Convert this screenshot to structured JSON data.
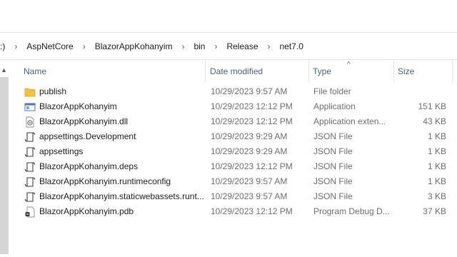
{
  "breadcrumb": {
    "prefix": ":)",
    "items": [
      "AspNetCore",
      "BlazorAppKohanyim",
      "bin",
      "Release",
      "net7.0"
    ]
  },
  "columns": {
    "name": "Name",
    "date": "Date modified",
    "type": "Type",
    "size": "Size"
  },
  "files": [
    {
      "icon": "folder-icon",
      "name": "publish",
      "date": "10/29/2023 9:57 AM",
      "type": "File folder",
      "size": ""
    },
    {
      "icon": "application-icon",
      "name": "BlazorAppKohanyim",
      "date": "10/29/2023 12:12 PM",
      "type": "Application",
      "size": "151 KB"
    },
    {
      "icon": "dll-icon",
      "name": "BlazorAppKohanyim.dll",
      "date": "10/29/2023 12:12 PM",
      "type": "Application exten...",
      "size": "43 KB"
    },
    {
      "icon": "json-file-icon",
      "name": "appsettings.Development",
      "date": "10/29/2023 9:29 AM",
      "type": "JSON File",
      "size": "1 KB"
    },
    {
      "icon": "json-file-icon",
      "name": "appsettings",
      "date": "10/29/2023 9:29 AM",
      "type": "JSON File",
      "size": "1 KB"
    },
    {
      "icon": "json-file-icon",
      "name": "BlazorAppKohanyim.deps",
      "date": "10/29/2023 12:12 PM",
      "type": "JSON File",
      "size": "1 KB"
    },
    {
      "icon": "json-file-icon",
      "name": "BlazorAppKohanyim.runtimeconfig",
      "date": "10/29/2023 9:57 AM",
      "type": "JSON File",
      "size": "1 KB"
    },
    {
      "icon": "json-file-icon",
      "name": "BlazorAppKohanyim.staticwebassets.runt...",
      "date": "10/29/2023 9:57 AM",
      "type": "JSON File",
      "size": "3 KB"
    },
    {
      "icon": "pdb-file-icon",
      "name": "BlazorAppKohanyim.pdb",
      "date": "10/29/2023 12:12 PM",
      "type": "Program Debug D...",
      "size": "37 KB"
    }
  ],
  "colors": {
    "header_text": "#4c607a",
    "folder": "#f5c242",
    "secondary_text": "#6d6d6d"
  }
}
